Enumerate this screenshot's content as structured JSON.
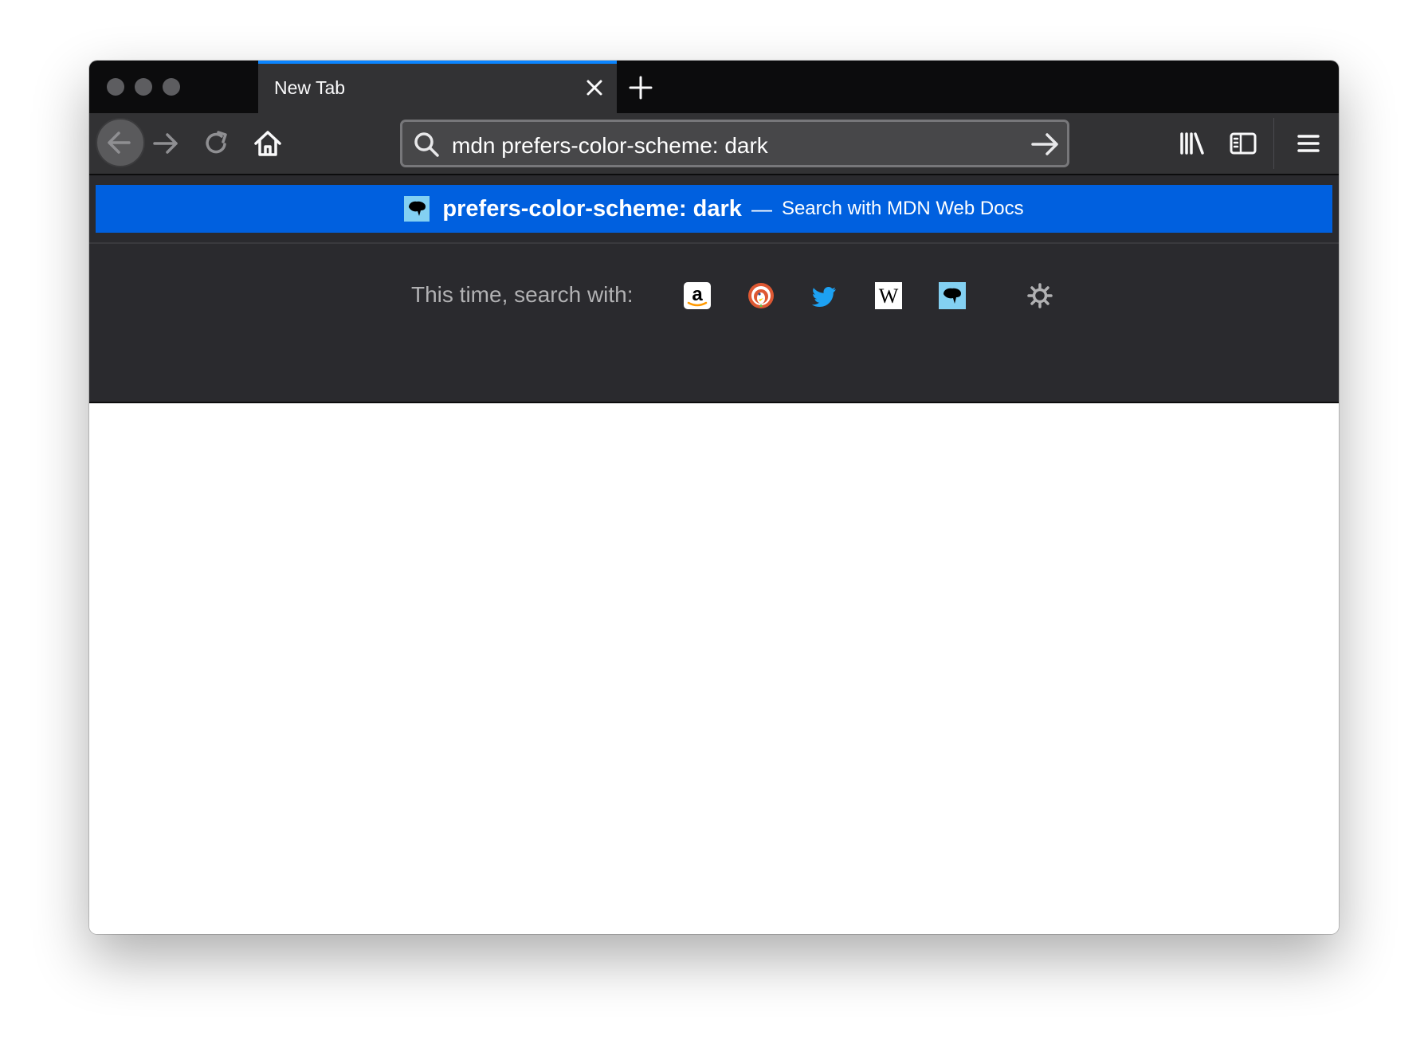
{
  "window": {
    "traffic_lights": [
      "close",
      "minimize",
      "zoom"
    ]
  },
  "tab": {
    "title": "New Tab",
    "accent_color": "#0a84ff",
    "close_icon": "close-icon"
  },
  "toolbar": {
    "buttons": [
      "back-icon",
      "forward-icon",
      "reload-icon",
      "home-icon"
    ],
    "right_buttons": [
      "library-icon",
      "sidebar-icon",
      "menu-icon"
    ]
  },
  "urlbar": {
    "value": "mdn prefers-color-scheme: dark",
    "search_icon": "search-icon",
    "go_icon": "arrow-right-icon"
  },
  "dropdown": {
    "result": {
      "query": "prefers-color-scheme: dark",
      "separator": "—",
      "action": "Search with MDN Web Docs",
      "highlight_color": "#0060df"
    },
    "one_off": {
      "label": "This time, search with:",
      "engines": [
        "amazon",
        "duckduckgo",
        "twitter",
        "wikipedia",
        "mdn-web-docs"
      ],
      "settings_icon": "gear-icon"
    }
  }
}
